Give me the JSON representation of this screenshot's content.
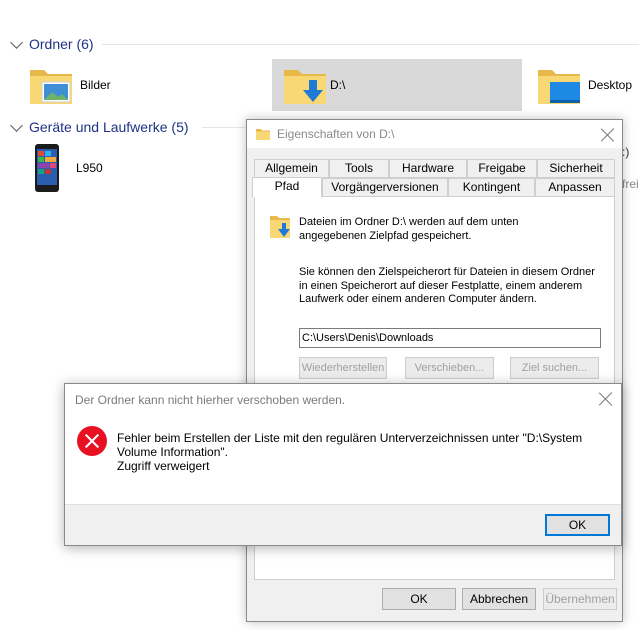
{
  "explorer": {
    "groups": [
      {
        "label": "Ordner (6)"
      },
      {
        "label": "Geräte und Laufwerke (5)"
      }
    ],
    "folders": [
      {
        "label": "Bilder"
      },
      {
        "label": "D:\\"
      },
      {
        "label": "Desktop"
      }
    ],
    "devices": [
      {
        "label": "L950"
      }
    ],
    "clipped_text": [
      ":)",
      "frei"
    ]
  },
  "properties": {
    "title": "Eigenschaften von D:\\",
    "tabs_row1": [
      "Allgemein",
      "Tools",
      "Hardware",
      "Freigabe",
      "Sicherheit"
    ],
    "tabs_row2": [
      "Pfad",
      "Vorgängerversionen",
      "Kontingent",
      "Anpassen"
    ],
    "active_tab": "Pfad",
    "description": "Dateien im Ordner D:\\ werden auf dem unten angegebenen Zielpfad gespeichert.",
    "info": "Sie können den Zielspeicherort für Dateien in diesem Ordner in einen Speicherort auf dieser Festplatte, einem anderem Laufwerk oder einem anderen Computer ändern.",
    "path_value": "C:\\Users\\Denis\\Downloads",
    "buttons": {
      "restore": "Wiederherstellen",
      "move": "Verschieben...",
      "find": "Ziel suchen...",
      "ok": "OK",
      "cancel": "Abbrechen",
      "apply": "Übernehmen"
    }
  },
  "error": {
    "title": "Der Ordner kann nicht hierher verschoben werden.",
    "message_line1": "Fehler beim Erstellen der Liste mit den regulären Unterverzeichnissen unter \"D:\\System",
    "message_line2": "Volume Information\".",
    "message_line3": "Zugriff verweigert",
    "ok": "OK"
  },
  "colors": {
    "group_header": "#1e3287",
    "accent": "#0078d7",
    "error_red": "#e81123",
    "folder_yellow": "#f8d775"
  }
}
